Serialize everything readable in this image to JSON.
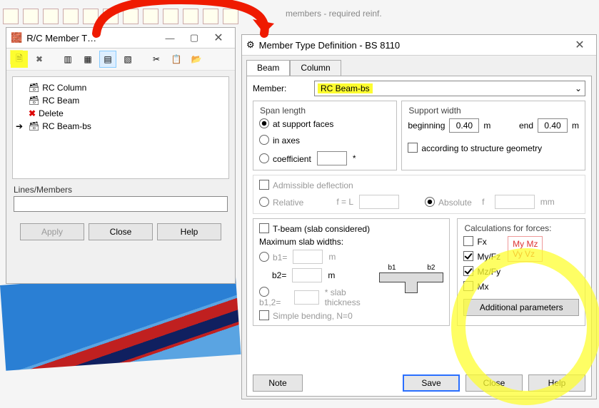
{
  "bg_tab_text": "members - required reinf.",
  "windowA": {
    "title": "R/C Member T…",
    "tree": [
      {
        "icon": "col",
        "label": "RC Column"
      },
      {
        "icon": "beam",
        "label": "RC Beam"
      },
      {
        "icon": "del",
        "label": "Delete"
      },
      {
        "icon": "beam",
        "label": "RC Beam-bs",
        "current": true
      }
    ],
    "lines_label": "Lines/Members",
    "apply": "Apply",
    "close": "Close",
    "help": "Help"
  },
  "windowB": {
    "title": "Member Type Definition - BS 8110",
    "tabs": [
      "Beam",
      "Column"
    ],
    "member_label": "Member:",
    "member_value": "RC Beam-bs",
    "span": {
      "title": "Span length",
      "opt_support": "at support faces",
      "opt_axes": "in axes",
      "opt_coef": "coefficient"
    },
    "support": {
      "title": "Support width",
      "beg_label": "beginning",
      "beg_val": "0.40",
      "end_label": "end",
      "end_val": "0.40",
      "unit": "m",
      "geom": "according to structure geometry"
    },
    "deflection": {
      "adm": "Admissible deflection",
      "rel": "Relative",
      "feq": "f = L",
      "abs": "Absolute",
      "flabel": "f",
      "unit": "mm"
    },
    "tbeam": {
      "chk": "T-beam (slab considered)",
      "max": "Maximum slab widths:",
      "b1": "b1=",
      "b2": "b2=",
      "b12": "b1,2=",
      "unit": "m",
      "slabthk": "* slab thickness",
      "simple": "Simple bending, N=0",
      "dim_b1": "b1",
      "dim_b2": "b2"
    },
    "calc": {
      "title": "Calculations for forces:",
      "fx": "Fx",
      "myfz": "My/Fz",
      "mzfy": "Mz/Fy",
      "mx": "Mx",
      "box1": "My Mz",
      "box2": "Vy Vz",
      "addl": "Additional parameters"
    },
    "note": "Note",
    "save": "Save",
    "close": "Close",
    "help": "Help"
  }
}
